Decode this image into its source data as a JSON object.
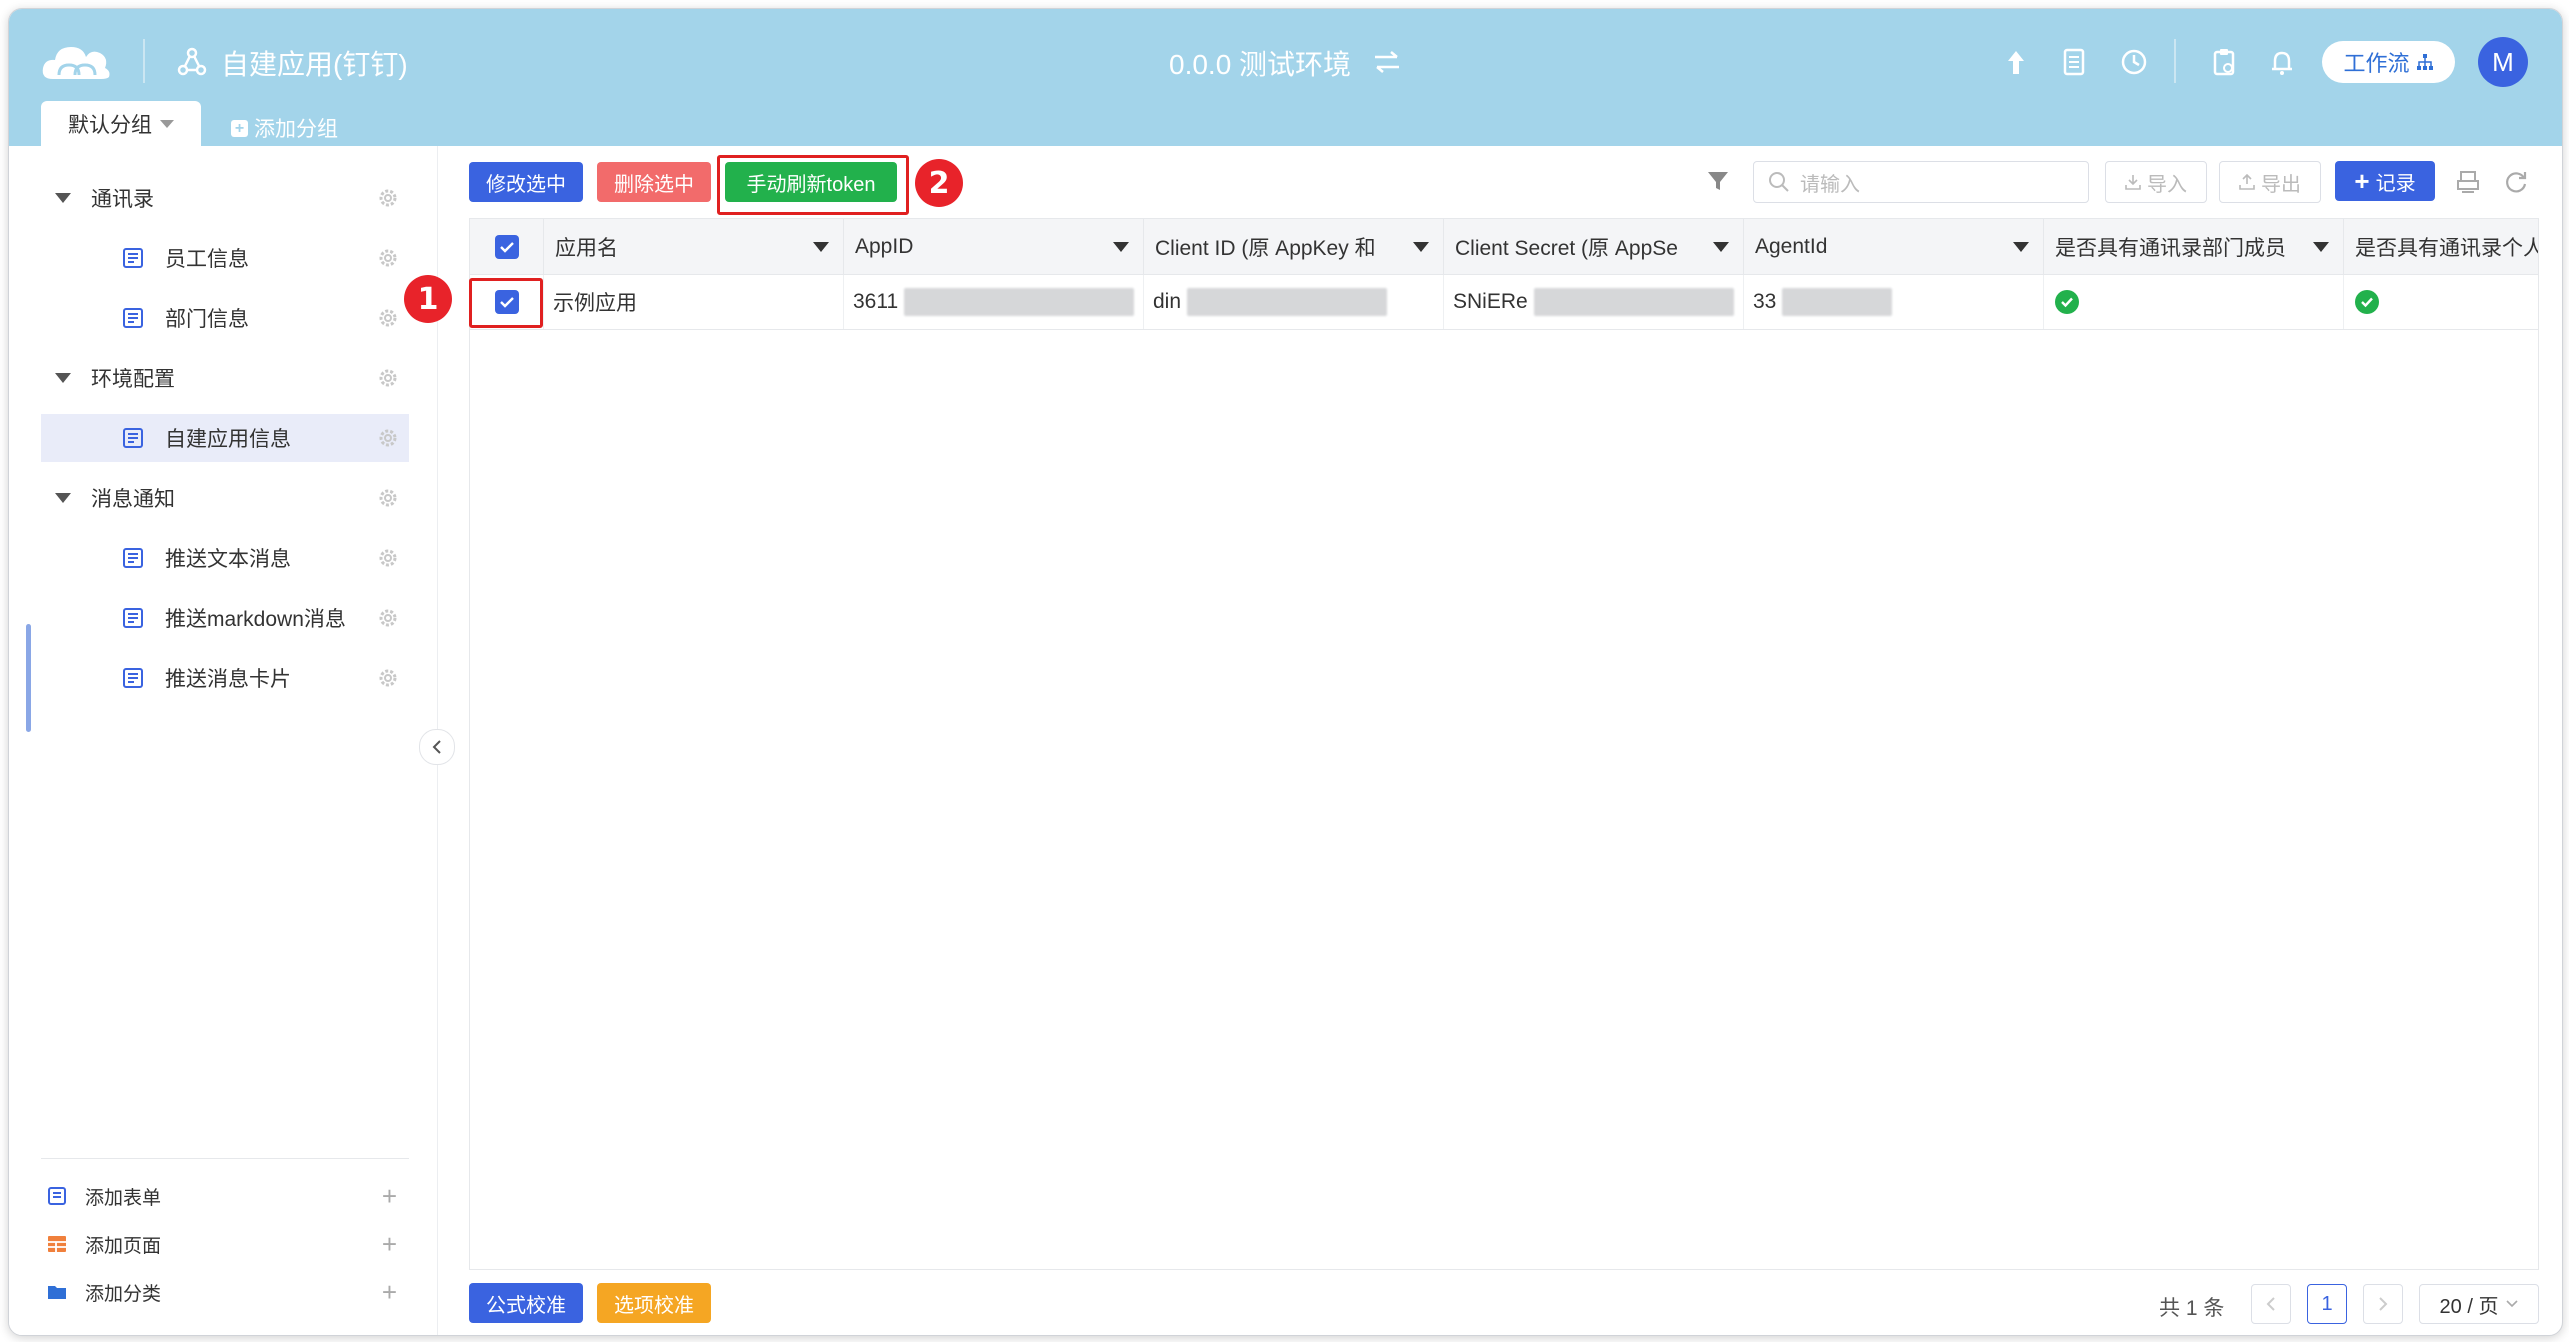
{
  "header": {
    "app_title": "自建应用(钉钉)",
    "env_title": "0.0.0 测试环境",
    "workflow_label": "工作流",
    "avatar_letter": "M",
    "colors": {
      "bar": "#a3d4ea",
      "avatar": "#3a63e0"
    }
  },
  "tabs": {
    "active_label": "默认分组",
    "add_label": "添加分组"
  },
  "sidebar": {
    "groups": [
      {
        "label": "通讯录",
        "items": [
          "员工信息",
          "部门信息"
        ]
      },
      {
        "label": "环境配置",
        "items": [
          "自建应用信息"
        ]
      },
      {
        "label": "消息通知",
        "items": [
          "推送文本消息",
          "推送markdown消息",
          "推送消息卡片"
        ]
      }
    ],
    "active_item": "自建应用信息",
    "bottom": {
      "add_form": "添加表单",
      "add_page": "添加页面",
      "add_category": "添加分类"
    }
  },
  "toolbar": {
    "edit_selected": "修改选中",
    "delete_selected": "删除选中",
    "refresh_token": "手动刷新token",
    "search_placeholder": "请输入",
    "import": "导入",
    "export": "导出",
    "add_record": "记录"
  },
  "annotations": {
    "badge1": "1",
    "badge2": "2"
  },
  "table": {
    "columns": [
      "应用名",
      "AppID",
      "Client ID (原 AppKey 和",
      "Client Secret (原 AppSe",
      "AgentId",
      "是否具有通讯录部门成员",
      "是否具有通讯录个人"
    ],
    "rows": [
      {
        "name": "示例应用",
        "appid": "3611",
        "client_id": "din",
        "client_secret": "SNiERe",
        "agent_id": "33",
        "dept_perm": true,
        "personal_perm": true
      }
    ]
  },
  "footer": {
    "formula_check": "公式校准",
    "option_check": "选项校准",
    "total": "共 1 条",
    "current_page": "1",
    "page_size": "20 / 页"
  }
}
